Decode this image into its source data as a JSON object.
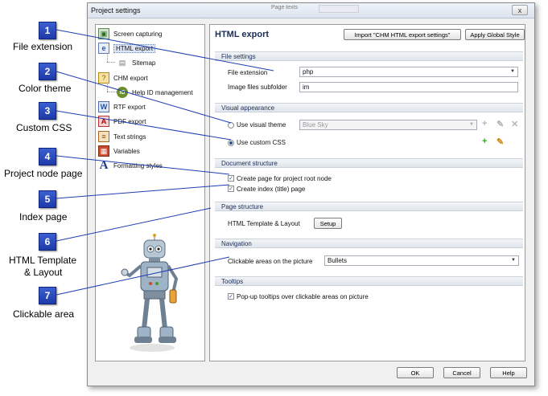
{
  "callouts": [
    {
      "num": "1",
      "label": "File extension"
    },
    {
      "num": "2",
      "label": "Color theme"
    },
    {
      "num": "3",
      "label": "Custom CSS"
    },
    {
      "num": "4",
      "label": "Project node page"
    },
    {
      "num": "5",
      "label": "Index page"
    },
    {
      "num": "6",
      "label_line1": "HTML Template",
      "label_line2": "& Layout"
    },
    {
      "num": "7",
      "label": "Clickable area"
    }
  ],
  "window": {
    "title": "Project settings",
    "close_label": "x",
    "ghost_tab": "Page texts"
  },
  "nav": {
    "items": [
      {
        "label": "Screen capturing",
        "icon": "screen-capture-icon"
      },
      {
        "label": "HTML export",
        "icon": "html-export-icon"
      },
      {
        "label": "Sitemap",
        "icon": "sitemap-icon"
      },
      {
        "label": "CHM export",
        "icon": "chm-export-icon"
      },
      {
        "label": "Help ID management",
        "icon": "help-id-icon"
      },
      {
        "label": "RTF export",
        "icon": "rtf-export-icon"
      },
      {
        "label": "PDF export",
        "icon": "pdf-export-icon"
      },
      {
        "label": "Text strings",
        "icon": "text-strings-icon"
      },
      {
        "label": "Variables",
        "icon": "variables-icon"
      },
      {
        "label": "Formatting styles",
        "icon": "formatting-styles-icon"
      }
    ]
  },
  "content": {
    "heading": "HTML export",
    "import_button": "Import \"CHM HTML export settings\"",
    "apply_button": "Apply Global Style",
    "sections": {
      "file_settings": "File settings",
      "visual_appearance": "Visual appearance",
      "document_structure": "Document structure",
      "page_structure": "Page structure",
      "navigation": "Navigation",
      "tooltips": "Tooltips"
    },
    "file_extension_label": "File extension",
    "file_extension_value": "php",
    "image_subfolder_label": "Image files subfolder",
    "image_subfolder_value": "im",
    "use_visual_theme_label": "Use visual theme",
    "visual_theme_value": "Blue Sky",
    "use_custom_css_label": "Use custom CSS",
    "create_root_page_label": "Create page for project root node",
    "create_index_label": "Create index (title) page",
    "template_label": "HTML Template & Layout",
    "setup_button": "Setup",
    "clickable_areas_label": "Clickable areas on the picture",
    "clickable_areas_value": "Bullets",
    "tooltips_label": "Pop-up tooltips over clickable areas on picture"
  },
  "footer": {
    "ok": "OK",
    "cancel": "Cancel",
    "help": "Help"
  },
  "colors": {
    "callout_blue": "#2a4cc0",
    "section_text": "#1a2d55",
    "add_green": "#3aa02c"
  }
}
